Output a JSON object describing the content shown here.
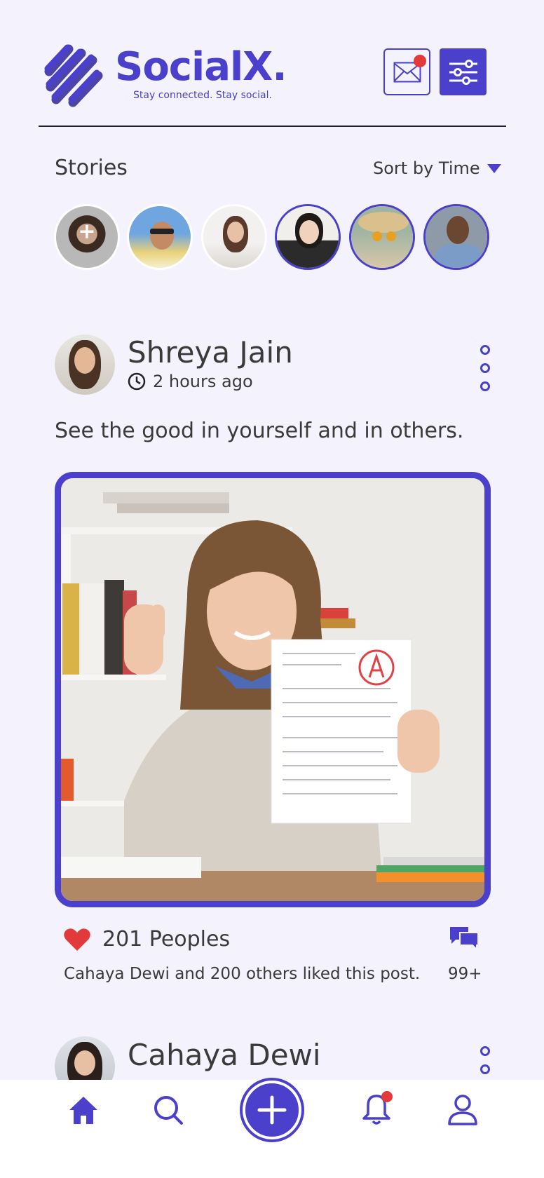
{
  "app": {
    "brand": "SocialX.",
    "tagline": "Stay connected. Stay social."
  },
  "colors": {
    "accent": "#4a40cc",
    "background": "#f3f2fd",
    "notification": "#e23a3a"
  },
  "header": {
    "mail_icon": "mail-icon",
    "filter_icon": "sliders-icon"
  },
  "stories": {
    "title": "Stories",
    "sort_label": "Sort by Time",
    "items": [
      {
        "type": "add-story",
        "icon": "plus-icon"
      },
      {
        "type": "story",
        "seen": true
      },
      {
        "type": "story",
        "seen": true
      },
      {
        "type": "story",
        "seen": false
      },
      {
        "type": "story",
        "seen": false
      },
      {
        "type": "story",
        "seen": false
      }
    ]
  },
  "posts": [
    {
      "author": "Shreya Jain",
      "time": "2 hours ago",
      "caption": "See the good in yourself and in others.",
      "likes_label": "201 Peoples",
      "liked_by": "Cahaya Dewi and 200 others liked this post.",
      "comments_count": "99+"
    },
    {
      "author": "Cahaya Dewi"
    }
  ],
  "bottom_nav": {
    "items": [
      "home-icon",
      "search-icon",
      "create-icon",
      "bell-icon",
      "profile-icon"
    ]
  }
}
